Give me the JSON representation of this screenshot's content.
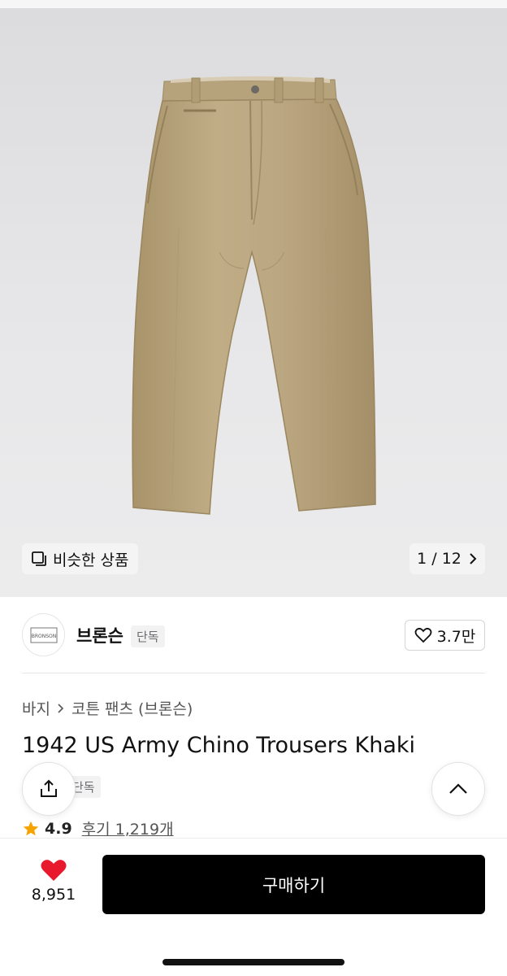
{
  "gallery": {
    "similar_label": "비슷한 상품",
    "page_current": "1",
    "page_total": "12",
    "page_separator": "/"
  },
  "brand": {
    "logo_text": "BRONSON",
    "name": "브론슨",
    "badge": "단독",
    "likes": "3.7만"
  },
  "breadcrumb": {
    "items": [
      "바지",
      "코튼 팬츠 (브론슨)"
    ]
  },
  "product": {
    "title": "1942 US Army Chino Trousers Khaki",
    "badge": "단독",
    "rating": "4.9",
    "reviews": "후기 1,219개"
  },
  "bottom": {
    "wish_count": "8,951",
    "buy_label": "구매하기"
  },
  "colors": {
    "khaki": "#b9a57e",
    "buy_button": "#000000",
    "heart": "#e8192c",
    "star": "#f5a300"
  }
}
